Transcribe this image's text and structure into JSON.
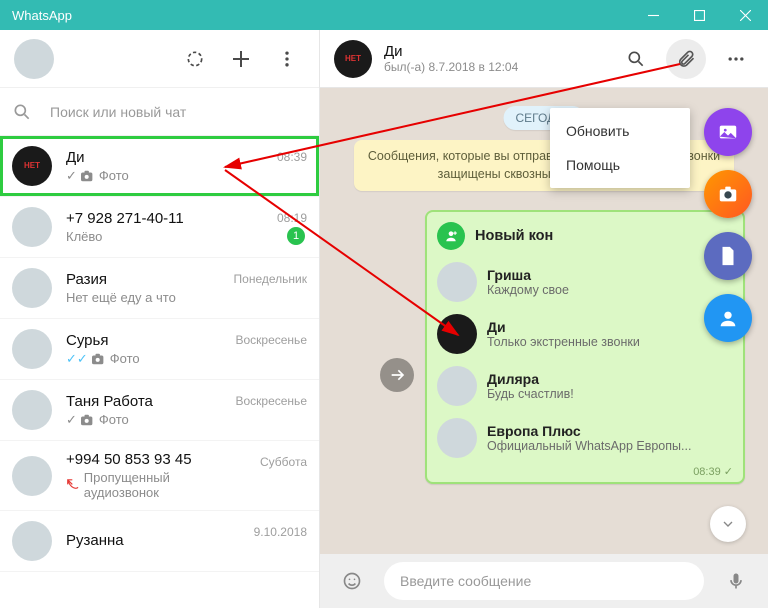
{
  "window": {
    "title": "WhatsApp"
  },
  "sidebar": {
    "search_placeholder": "Поиск или новый чат",
    "chats": [
      {
        "name": "Ди",
        "sub": "Фото",
        "time": "08:39",
        "tick": "single",
        "cam": true,
        "selected": true
      },
      {
        "name": "+7 928 271-40-11",
        "sub": "Клёво",
        "time": "08:19",
        "unread": "1"
      },
      {
        "name": "Разия",
        "sub": "Нет ещё еду а что",
        "time": "Понедельник"
      },
      {
        "name": "Сурья",
        "sub": "Фото",
        "time": "Воскресенье",
        "tick": "blue",
        "cam": true
      },
      {
        "name": "Таня Работа",
        "sub": "Фото",
        "time": "Воскресенье",
        "tick": "single",
        "cam": true
      },
      {
        "name": "+994 50 853 93 45",
        "sub": "Пропущенный аудиозвонок",
        "time": "Суббота",
        "missed": true
      },
      {
        "name": "Рузанна",
        "sub": "",
        "time": "9.10.2018"
      }
    ]
  },
  "header": {
    "name": "Ди",
    "status": "был(-а) 8.7.2018 в 12:04"
  },
  "day_label": "СЕГОДНЯ",
  "encryption": "Сообщения, которые вы отправляете в данный чат, и звонки защищены сквозным шифрованием.",
  "dropdown": {
    "items": [
      "Обновить",
      "Помощь"
    ]
  },
  "contact_card": {
    "title": "Новый кон",
    "time": "08:39",
    "items": [
      {
        "name": "Гриша",
        "status": "Каждому свое"
      },
      {
        "name": "Ди",
        "status": "Только экстренные звонки"
      },
      {
        "name": "Диляра",
        "status": "Будь счастлив!"
      },
      {
        "name": "Европа Плюс",
        "status": "Официальный WhatsApp Европы..."
      }
    ]
  },
  "input": {
    "placeholder": "Введите сообщение"
  }
}
